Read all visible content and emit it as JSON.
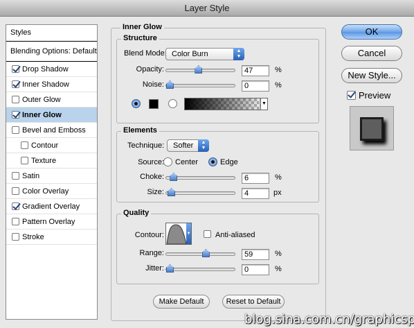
{
  "window": {
    "title": "Layer Style"
  },
  "styles_list": {
    "header": "Styles",
    "blending_options": "Blending Options: Default",
    "items": [
      {
        "label": "Drop Shadow",
        "checked": true,
        "selected": false,
        "indent": false
      },
      {
        "label": "Inner Shadow",
        "checked": true,
        "selected": false,
        "indent": false
      },
      {
        "label": "Outer Glow",
        "checked": false,
        "selected": false,
        "indent": false
      },
      {
        "label": "Inner Glow",
        "checked": true,
        "selected": true,
        "indent": false
      },
      {
        "label": "Bevel and Emboss",
        "checked": false,
        "selected": false,
        "indent": false
      },
      {
        "label": "Contour",
        "checked": false,
        "selected": false,
        "indent": true
      },
      {
        "label": "Texture",
        "checked": false,
        "selected": false,
        "indent": true
      },
      {
        "label": "Satin",
        "checked": false,
        "selected": false,
        "indent": false
      },
      {
        "label": "Color Overlay",
        "checked": false,
        "selected": false,
        "indent": false
      },
      {
        "label": "Gradient Overlay",
        "checked": true,
        "selected": false,
        "indent": false
      },
      {
        "label": "Pattern Overlay",
        "checked": false,
        "selected": false,
        "indent": false
      },
      {
        "label": "Stroke",
        "checked": false,
        "selected": false,
        "indent": false
      }
    ]
  },
  "panel": {
    "title": "Inner Glow",
    "structure": {
      "title": "Structure",
      "blend_mode_label": "Blend Mode:",
      "blend_mode_value": "Color Burn",
      "opacity_label": "Opacity:",
      "opacity_value": "47",
      "opacity_level": 0.47,
      "noise_label": "Noise:",
      "noise_value": "0",
      "noise_level": 0,
      "percent": "%",
      "color_mode": "solid",
      "color": "#000000"
    },
    "elements": {
      "title": "Elements",
      "technique_label": "Technique:",
      "technique_value": "Softer",
      "source_label": "Source:",
      "source_center": "Center",
      "source_edge": "Edge",
      "source_selected": "Edge",
      "choke_label": "Choke:",
      "choke_value": "6",
      "choke_level": 0.06,
      "size_label": "Size:",
      "size_value": "4",
      "size_unit": "px",
      "percent": "%"
    },
    "quality": {
      "title": "Quality",
      "contour_label": "Contour:",
      "anti_aliased_label": "Anti-aliased",
      "anti_aliased_checked": false,
      "range_label": "Range:",
      "range_value": "59",
      "range_level": 0.59,
      "jitter_label": "Jitter:",
      "jitter_value": "0",
      "jitter_level": 0,
      "percent": "%"
    },
    "make_default": "Make Default",
    "reset_to_default": "Reset to Default"
  },
  "actions": {
    "ok": "OK",
    "cancel": "Cancel",
    "new_style": "New Style...",
    "preview_label": "Preview",
    "preview_checked": true
  },
  "watermark": "blog.sina.com.cn/graphicspy"
}
